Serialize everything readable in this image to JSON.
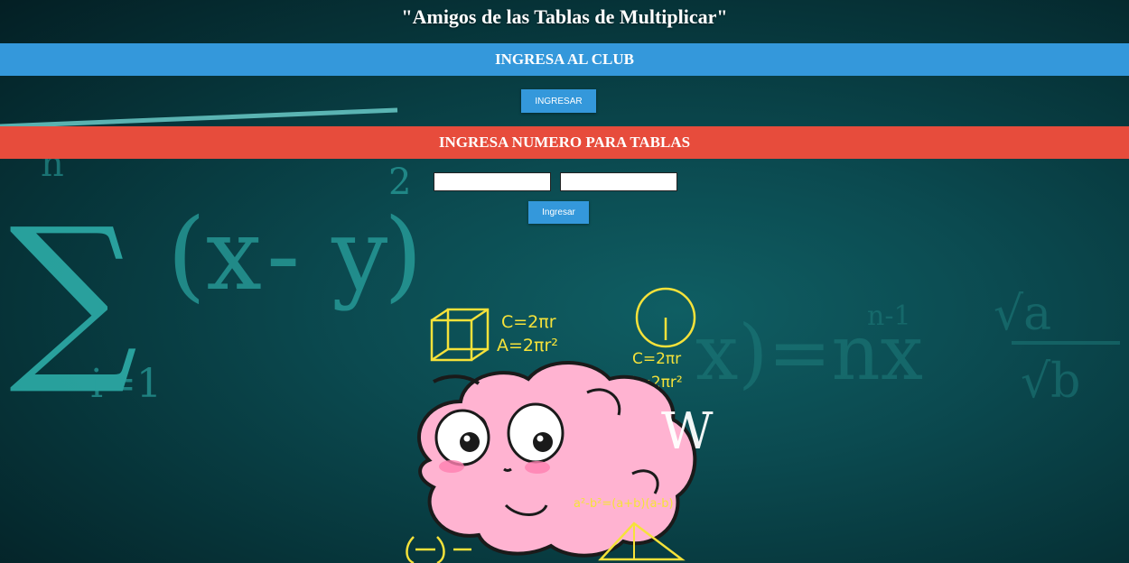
{
  "header": {
    "title": "\"Amigos de las Tablas de Multiplicar\""
  },
  "club": {
    "heading": "INGRESA AL CLUB",
    "button_label": "INGRESAR"
  },
  "tables": {
    "heading": "INGRESA NUMERO PARA TABLAS",
    "input_1_value": "",
    "input_2_value": "",
    "button_label": "Ingresar"
  },
  "illustration": {
    "formula_1": "C=2πr",
    "formula_2": "A=2πr²",
    "formula_3": "C=2πr",
    "formula_4": "A=2πr²",
    "formula_5": "a²-b²=(a+b)(a-b)",
    "watermark": "W"
  },
  "background": {
    "eq_1": "∑",
    "eq_2": "(x",
    "eq_3": "- y",
    "eq_4": ")",
    "eq_5": "2",
    "eq_6": "i=1",
    "eq_7": "n",
    "eq_8": "x)=nx",
    "eq_9": "n-1",
    "eq_10": "√a",
    "eq_11": "√b"
  },
  "colors": {
    "club_band": "#3498db",
    "tables_band": "#e74c3c",
    "button": "#3498db",
    "brain": "#ffb3d1"
  }
}
